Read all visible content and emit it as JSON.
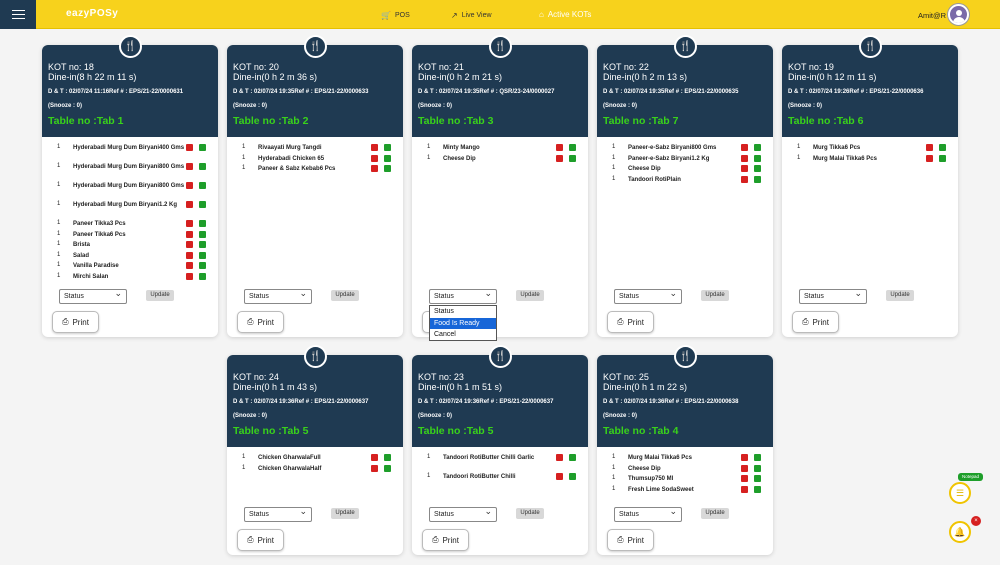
{
  "header": {
    "logo": "eazyPOSy",
    "nav": [
      {
        "label": "POS",
        "icon": "cart-icon"
      },
      {
        "label": "Live View",
        "icon": "chart-line-icon"
      },
      {
        "label": "Active KOTs",
        "icon": "building-icon"
      }
    ],
    "user": "Amit@R"
  },
  "status_options": [
    "Status",
    "Food Is Ready",
    "Cancel"
  ],
  "labels": {
    "status": "Status",
    "update": "Update",
    "print": "Print"
  },
  "kots": [
    {
      "kot": "KOT no: 18",
      "dine": "Dine-in(8 h 22 m 11 s)",
      "dt": "D & T : 02/07/24 11:16Ref # : EPS/21-22/0000631",
      "snooze": "(Snooze : 0)",
      "table": "Table no :Tab 1",
      "items": [
        {
          "qty": "1",
          "name": "Hyderabadi Murg Dum Biryani400 Gms"
        },
        {
          "qty": "1",
          "name": "Hyderabadi Murg Dum Biryani800 Gms"
        },
        {
          "qty": "1",
          "name": "Hyderabadi Murg Dum Biryani800 Gms"
        },
        {
          "qty": "1",
          "name": "Hyderabadi Murg Dum Biryani1.2 Kg"
        },
        {
          "qty": "1",
          "name": "Paneer Tikka3 Pcs"
        },
        {
          "qty": "1",
          "name": "Paneer Tikka6 Pcs"
        },
        {
          "qty": "1",
          "name": "Brista"
        },
        {
          "qty": "1",
          "name": "Salad"
        },
        {
          "qty": "1",
          "name": "Vanilla Paradise"
        },
        {
          "qty": "1",
          "name": "Mirchi Salan"
        }
      ]
    },
    {
      "kot": "KOT no: 20",
      "dine": "Dine-in(0 h 2 m 36 s)",
      "dt": "D & T : 02/07/24 19:35Ref # : EPS/21-22/0000633",
      "snooze": "(Snooze : 0)",
      "table": "Table no :Tab 2",
      "items": [
        {
          "qty": "1",
          "name": "Rivaayati Murg Tangdi"
        },
        {
          "qty": "1",
          "name": "Hyderabadi Chicken 65"
        },
        {
          "qty": "1",
          "name": "Paneer & Sabz Kebab6 Pcs"
        }
      ]
    },
    {
      "kot": "KOT no: 21",
      "dine": "Dine-in(0 h 2 m 21 s)",
      "dt": "D & T : 02/07/24 19:35Ref # : QSR/23-24/0000027",
      "snooze": "(Snooze : 0)",
      "table": "Table no :Tab 3",
      "items": [
        {
          "qty": "1",
          "name": "Minty Mango"
        },
        {
          "qty": "1",
          "name": "Cheese Dip"
        }
      ]
    },
    {
      "kot": "KOT no: 22",
      "dine": "Dine-in(0 h 2 m 13 s)",
      "dt": "D & T : 02/07/24 19:35Ref # : EPS/21-22/0000635",
      "snooze": "(Snooze : 0)",
      "table": "Table no :Tab 7",
      "items": [
        {
          "qty": "1",
          "name": "Paneer-e-Sabz Biryani800 Gms"
        },
        {
          "qty": "1",
          "name": "Paneer-e-Sabz Biryani1.2 Kg"
        },
        {
          "qty": "1",
          "name": "Cheese Dip"
        },
        {
          "qty": "1",
          "name": "Tandoori RotiPlain"
        }
      ]
    },
    {
      "kot": "KOT no: 19",
      "dine": "Dine-in(0 h 12 m 11 s)",
      "dt": "D & T : 02/07/24 19:26Ref # : EPS/21-22/0000636",
      "snooze": "(Snooze : 0)",
      "table": "Table no :Tab 6",
      "items": [
        {
          "qty": "1",
          "name": "Murg Tikka6 Pcs"
        },
        {
          "qty": "1",
          "name": "Murg Malai Tikka6 Pcs"
        }
      ]
    },
    {
      "kot": "KOT no: 24",
      "dine": "Dine-in(0 h 1 m 43 s)",
      "dt": "D & T : 02/07/24 19:36Ref # : EPS/21-22/0000637",
      "snooze": "(Snooze : 0)",
      "table": "Table no :Tab 5",
      "items": [
        {
          "qty": "1",
          "name": "Chicken GharwalaFull"
        },
        {
          "qty": "1",
          "name": "Chicken GharwalaHalf"
        }
      ]
    },
    {
      "kot": "KOT no: 23",
      "dine": "Dine-in(0 h 1 m 51 s)",
      "dt": "D & T : 02/07/24 19:36Ref # : EPS/21-22/0000637",
      "snooze": "(Snooze : 0)",
      "table": "Table no :Tab 5",
      "items": [
        {
          "qty": "1",
          "name": "Tandoori RotiButter Chilli Garlic"
        },
        {
          "qty": "1",
          "name": "Tandoori RotiButter Chilli"
        }
      ]
    },
    {
      "kot": "KOT no: 25",
      "dine": "Dine-in(0 h 1 m 22 s)",
      "dt": "D & T : 02/07/24 19:36Ref # : EPS/21-22/0000638",
      "snooze": "(Snooze : 0)",
      "table": "Table no :Tab 4",
      "items": [
        {
          "qty": "1",
          "name": "Murg Malai Tikka6 Pcs"
        },
        {
          "qty": "1",
          "name": "Cheese Dip"
        },
        {
          "qty": "1",
          "name": "Thumsup750 Ml"
        },
        {
          "qty": "1",
          "name": "Fresh Lime SodaSweet"
        }
      ]
    }
  ],
  "fabs": {
    "notepad_label": "Notepad",
    "notification_count": "×"
  },
  "colors": {
    "topbar": "#f7d21c",
    "card_header": "#1f3a52",
    "table_no": "#39d21a",
    "red_square": "#d62020",
    "green_square": "#1e9e2a"
  }
}
